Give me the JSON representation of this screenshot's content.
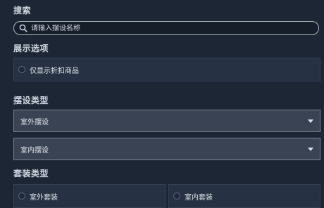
{
  "search": {
    "title": "搜索",
    "placeholder": "请输入摆设名称",
    "icon": "search-icon"
  },
  "display_options": {
    "title": "展示选项",
    "discount_only_label": "仅显示折扣商品"
  },
  "furnishing_type": {
    "title": "摆设类型",
    "dropdowns": [
      {
        "label": "室外摆设"
      },
      {
        "label": "室内摆设"
      }
    ]
  },
  "set_type": {
    "title": "套装类型",
    "options": [
      {
        "label": "室外套装"
      },
      {
        "label": "室内套装"
      }
    ]
  },
  "colors": {
    "background": "#1d2634",
    "panel": "#263244",
    "dropdown": "#3a4354",
    "text": "#dfe3ea"
  }
}
